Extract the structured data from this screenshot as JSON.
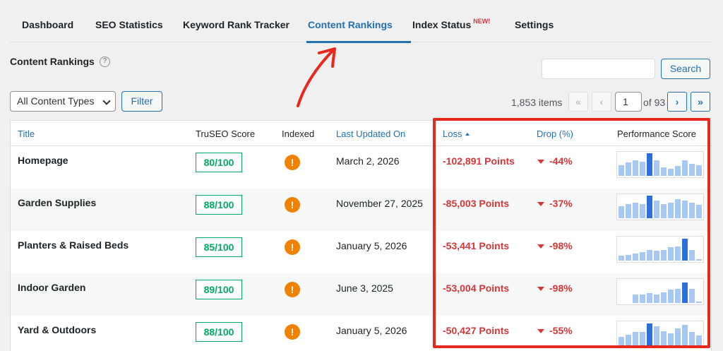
{
  "tabs": [
    {
      "label": "Dashboard",
      "active": false
    },
    {
      "label": "SEO Statistics",
      "active": false
    },
    {
      "label": "Keyword Rank Tracker",
      "active": false
    },
    {
      "label": "Content Rankings",
      "active": true
    },
    {
      "label": "Index Status",
      "active": false,
      "badge": "NEW!"
    },
    {
      "label": "Settings",
      "active": false
    }
  ],
  "page": {
    "title": "Content Rankings",
    "help_icon": "question-circle-icon"
  },
  "search": {
    "value": "",
    "placeholder": "",
    "button_label": "Search"
  },
  "filters": {
    "content_type_selected": "All Content Types",
    "filter_button_label": "Filter"
  },
  "pagination": {
    "items_count": "1,853 items",
    "first": "«",
    "prev": "‹",
    "current_page": "1",
    "of_label": "of 93",
    "next": "›",
    "last": "»"
  },
  "table": {
    "columns": {
      "title": "Title",
      "truseo_score": "TruSEO Score",
      "indexed": "Indexed",
      "last_updated": "Last Updated On",
      "loss": "Loss",
      "drop": "Drop (%)",
      "performance": "Performance Score"
    },
    "rows": [
      {
        "title": "Homepage",
        "score": "80/100",
        "indexed_icon": "warning-exclamation-icon",
        "updated": "March 2, 2026",
        "loss": "-102,891 Points",
        "drop": "-44%",
        "spark": [
          0.45,
          0.55,
          0.65,
          0.6,
          0.95,
          0.65,
          0.35,
          0.3,
          0.4,
          0.65,
          0.5,
          0.45
        ],
        "spark_peak": 4
      },
      {
        "title": "Garden Supplies",
        "score": "88/100",
        "indexed_icon": "warning-exclamation-icon",
        "updated": "November 27, 2025",
        "loss": "-85,003 Points",
        "drop": "-37%",
        "spark": [
          0.5,
          0.6,
          0.65,
          0.6,
          0.95,
          0.75,
          0.6,
          0.65,
          0.8,
          0.75,
          0.65,
          0.55
        ],
        "spark_peak": 4
      },
      {
        "title": "Planters & Raised Beds",
        "score": "85/100",
        "indexed_icon": "warning-exclamation-icon",
        "updated": "January 5, 2026",
        "loss": "-53,441 Points",
        "drop": "-98%",
        "spark": [
          0.2,
          0.25,
          0.3,
          0.35,
          0.45,
          0.4,
          0.45,
          0.55,
          0.6,
          0.9,
          0.45,
          0.05
        ],
        "spark_peak": 9
      },
      {
        "title": "Indoor Garden",
        "score": "89/100",
        "indexed_icon": "warning-exclamation-icon",
        "updated": "June 3, 2025",
        "loss": "-53,004 Points",
        "drop": "-98%",
        "spark": [
          0.0,
          0.0,
          0.35,
          0.35,
          0.4,
          0.35,
          0.45,
          0.55,
          0.6,
          0.85,
          0.6,
          0.05
        ],
        "spark_peak": 9
      },
      {
        "title": "Yard & Outdoors",
        "score": "88/100",
        "indexed_icon": "warning-exclamation-icon",
        "updated": "January 5, 2026",
        "loss": "-50,427 Points",
        "drop": "-55%",
        "spark": [
          0.35,
          0.45,
          0.55,
          0.55,
          0.9,
          0.8,
          0.6,
          0.5,
          0.7,
          0.85,
          0.55,
          0.4
        ],
        "spark_peak": 4
      }
    ]
  },
  "annotations": {
    "highlight_color": "#e8271d",
    "arrow_color": "#e8271d"
  },
  "colors": {
    "accent": "#2271b1",
    "loss": "#d63638",
    "score_good": "#00aa63",
    "indexed_warning": "#f18200"
  }
}
